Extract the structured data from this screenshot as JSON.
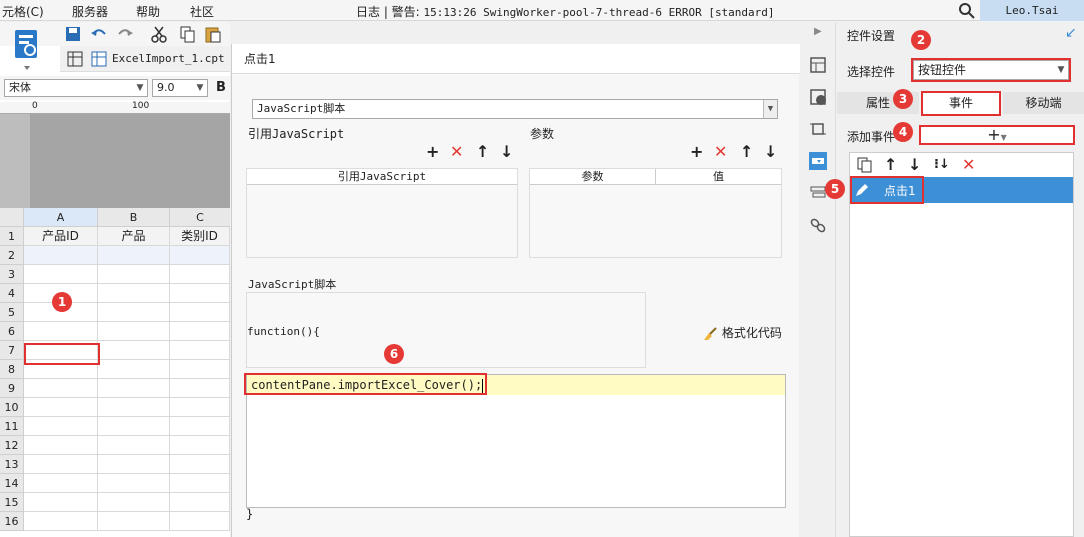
{
  "menubar": {
    "items": [
      "元格(C)",
      "服务器",
      "帮助",
      "社区"
    ],
    "log_prefix": "日志 | 警告:",
    "log_text": "15:13:26 SwingWorker-pool-7-thread-6 ERROR [standard]",
    "user": "Leo.Tsai"
  },
  "designer": {
    "file_tab": "ExcelImport_1.cpt *",
    "font_name": "宋体",
    "font_size": "9.0",
    "bold_label": "B",
    "ruler_marks": [
      "0",
      "100"
    ],
    "columns": [
      "A",
      "B",
      "C"
    ],
    "rows": [
      "1",
      "2",
      "3",
      "4",
      "5",
      "6",
      "7",
      "8",
      "9",
      "10",
      "11",
      "12",
      "13",
      "14",
      "15",
      "16"
    ],
    "row1": [
      "产品ID",
      "产品",
      "类别ID"
    ]
  },
  "dialog": {
    "title": "点击1",
    "type_select": "JavaScript脚本",
    "ref_js_label": "引用JavaScript",
    "params_label": "参数",
    "ref_js_col": "引用JavaScript",
    "params_col1": "参数",
    "params_col2": "值",
    "script_label": "JavaScript脚本",
    "function_header": "function(){",
    "format_code": "格式化代码",
    "code_line": "contentPane.importExcel_Cover();",
    "closing_brace": "}"
  },
  "settings": {
    "title": "控件设置",
    "select_widget_label": "选择控件",
    "widget_value": "按钮控件",
    "tabs": [
      "属性",
      "事件",
      "移动端"
    ],
    "active_tab": "事件",
    "add_event_label": "添加事件",
    "add_symbol": "+",
    "event_item": "点击1"
  },
  "badges": [
    "1",
    "2",
    "3",
    "4",
    "5",
    "6"
  ],
  "colors": {
    "accent_red": "#e53935",
    "selection_blue": "#3d8fd6",
    "code_highlight": "#fffbc2"
  }
}
